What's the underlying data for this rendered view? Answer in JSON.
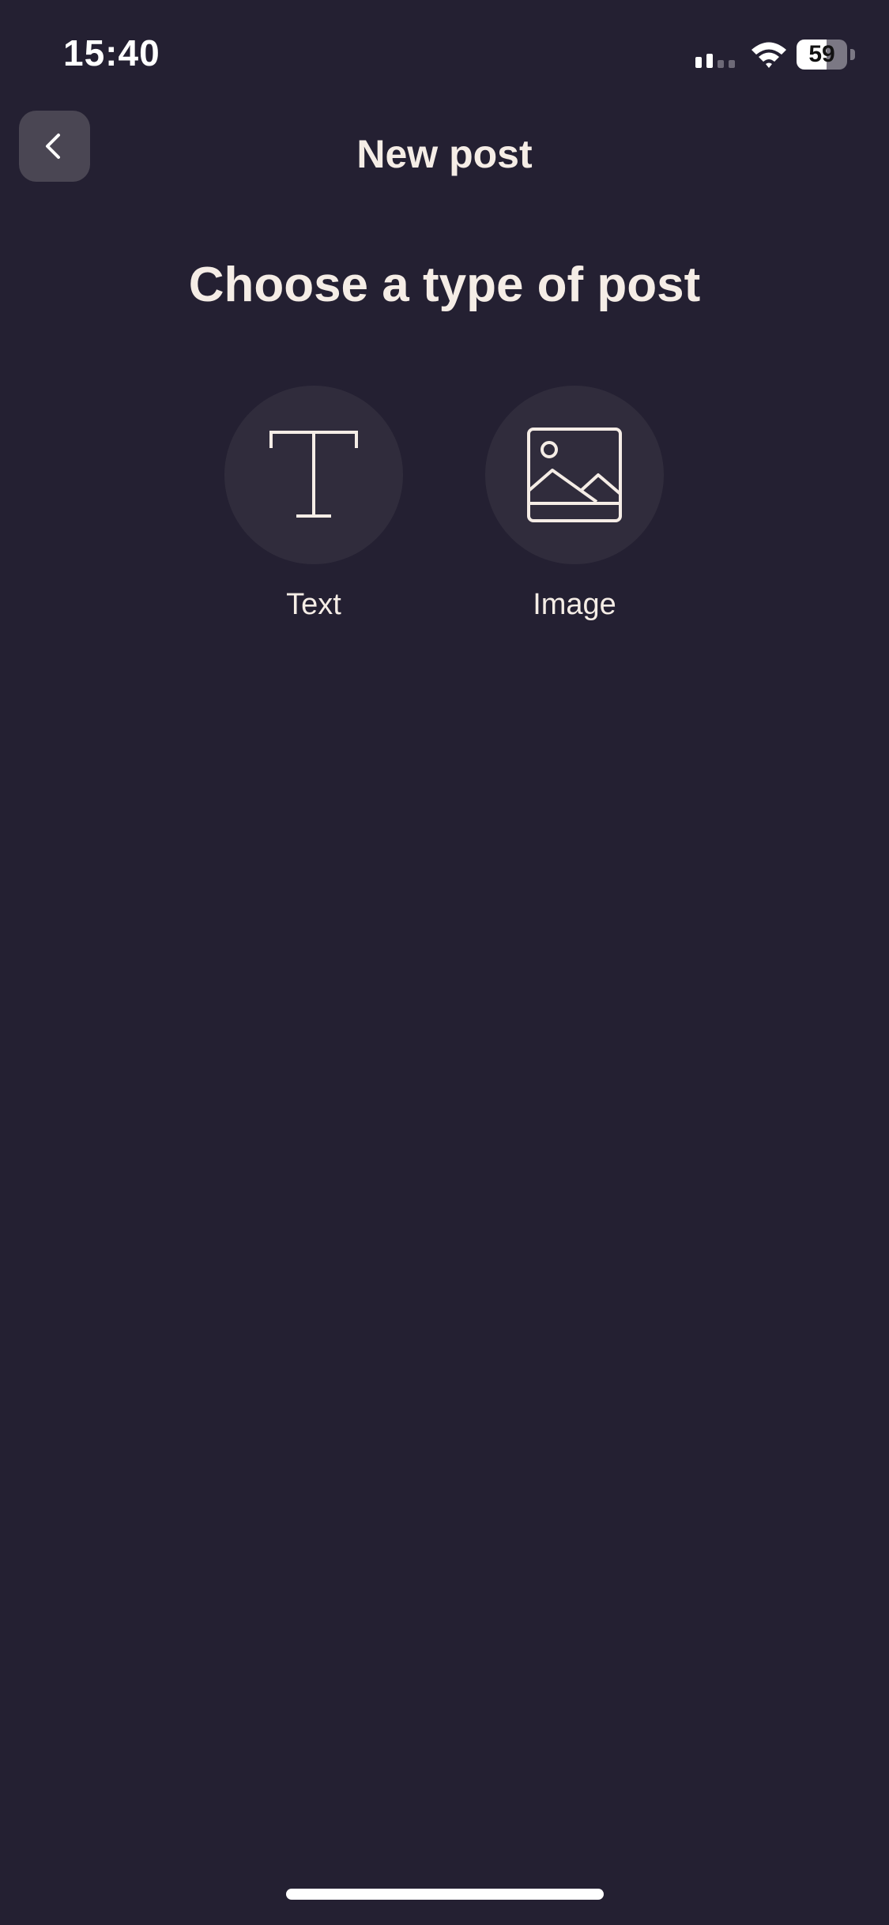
{
  "status_bar": {
    "time": "15:40",
    "battery_level": "59",
    "icons": [
      "signal-icon",
      "wifi-icon",
      "battery-icon"
    ]
  },
  "header": {
    "title": "New post",
    "back_icon": "chevron-left-icon"
  },
  "main": {
    "heading": "Choose a type of post",
    "options": [
      {
        "label": "Text",
        "icon": "text-type-icon"
      },
      {
        "label": "Image",
        "icon": "image-icon"
      }
    ]
  },
  "colors": {
    "background": "#242032",
    "circle": "#302c3c",
    "back_button": "#4a4653",
    "text": "#f5ede6"
  }
}
